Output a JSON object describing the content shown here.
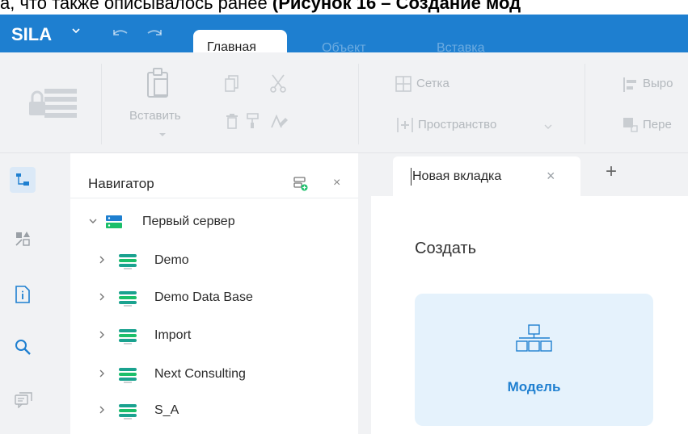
{
  "doc_line": {
    "prefix": "а, что также описывалось ранее ",
    "bold": "(Рисунок 16 – Создание мод"
  },
  "app": {
    "brand": "SILA"
  },
  "ribbon_tabs": [
    "Главная",
    "Объект",
    "Вставка"
  ],
  "ribbon": {
    "paste_label": "Вставить",
    "grid_label": "Сетка",
    "space_label": "Пространство",
    "align_label": "Выро",
    "move_label": "Пере"
  },
  "left_strip": [
    {
      "name": "navigator-icon",
      "active": true
    },
    {
      "name": "shapes-icon",
      "active": false
    },
    {
      "name": "properties-icon",
      "active": false
    },
    {
      "name": "search-icon",
      "active": false
    },
    {
      "name": "comments-icon",
      "active": false
    }
  ],
  "navigator": {
    "title": "Навигатор",
    "close": "×",
    "tree": [
      {
        "label": "Первый сервер",
        "type": "server",
        "expanded": true
      },
      {
        "label": "Demo",
        "type": "database",
        "expanded": false
      },
      {
        "label": "Demo Data Base",
        "type": "database",
        "expanded": false
      },
      {
        "label": "Import",
        "type": "database",
        "expanded": false
      },
      {
        "label": "Next Consulting",
        "type": "database",
        "expanded": false
      },
      {
        "label": "S_A",
        "type": "database",
        "expanded": false
      }
    ]
  },
  "tabs": {
    "active_label": "Новая вкладка",
    "close": "×",
    "new_tab": "+"
  },
  "main": {
    "create_heading": "Создать",
    "cards": [
      {
        "label": "Модель",
        "icon": "model-hierarchy-icon"
      }
    ]
  },
  "colors": {
    "brand_blue": "#1e7fd0",
    "ribbon_bg": "#f1f2f4",
    "card_bg": "#e5f2fc",
    "server_green": "#1bbf6a",
    "db_teal": "#1aa28f"
  }
}
